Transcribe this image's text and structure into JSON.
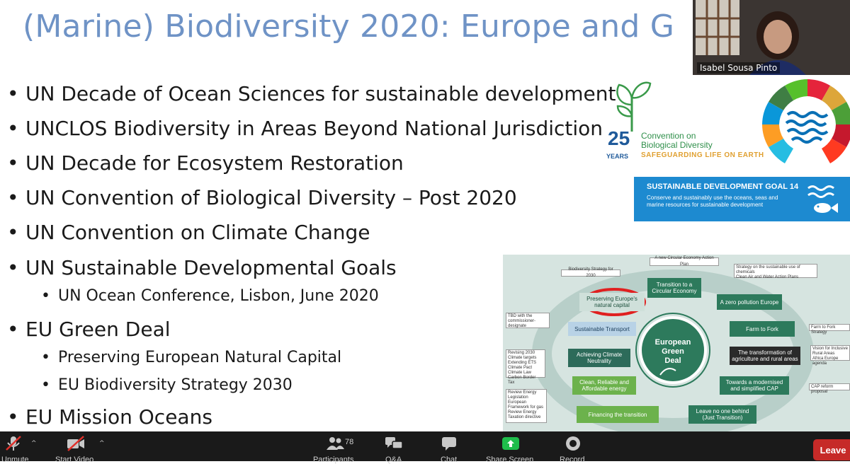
{
  "slide": {
    "title": "(Marine) Biodiversity 2020: Europe and G",
    "bullets": [
      "UN Decade of Ocean Sciences for sustainable development",
      "UNCLOS Biodiversity in Areas Beyond National Jurisdiction",
      "UN Decade for Ecosystem Restoration",
      "UN Convention of Biological Diversity – Post 2020",
      "UN Convention on Climate Change",
      "UN Sustainable Developmental Goals",
      "EU Green Deal",
      "EU Mission Oceans"
    ],
    "sub_bullets": [
      "UN Ocean Conference, Lisbon, June 2020",
      "Preserving European Natural Capital",
      "EU Biodiversity Strategy 2030"
    ],
    "cbd_logo": {
      "years_number": "25",
      "years_label": "YEARS",
      "line1": "Convention on",
      "line2": "Biological Diversity",
      "tagline": "SAFEGUARDING LIFE ON EARTH"
    },
    "sdg14": {
      "heading": "SUSTAINABLE DEVELOPMENT GOAL 14",
      "text": "Conserve and sustainably use the oceans, seas and marine resources for sustainable development"
    },
    "green_deal": {
      "center": "European Green Deal",
      "boxes": {
        "circular_plan": "A new Circular Economy Action Plan",
        "biodiversity_strategy": "Biodiversity Strategy for 2030",
        "chemicals": "Strategy on the sustainable use of chemicals",
        "clean_air": "Clean Air and Water Action Plans",
        "transition": "Transition to a Circular Economy",
        "preserving": "Preserving Europe's natural capital",
        "zero_pollution": "A zero pollution Europe",
        "tbd": "TBD with the commissioner-designate",
        "transport": "Sustainable Transport",
        "farm_to_fork": "Farm to Fork",
        "farm_to_fork_strategy": "Farm to Fork Strategy",
        "climate_notes": "Revising 2030 Climate targets\nExtending ETS\nClimate Pact\nClimate Law\nCarbon Border Tax",
        "climate_neutrality": "Achieving Climate Neutrality",
        "rural": "The transformation of agriculture and rural areas",
        "vision": "Vision for Inclusive Rural Areas\nAfrica Europe agenda",
        "energy": "Clean, Reliable and Affordable energy",
        "cap": "Towards a modernised and simplified CAP",
        "cap_reform": "CAP reform proposal",
        "energy_notes": "Review Energy Legislation\nEuropean Framework for gas\nReview Energy Taxation directive",
        "financing": "Financing the transition",
        "leave_no_one": "Leave no one behind (Just Transition)"
      }
    }
  },
  "video": {
    "participant_name": "Isabel Sousa Pinto"
  },
  "toolbar": {
    "unmute": "Unmute",
    "start_video": "Start Video",
    "participants": "Participants",
    "participants_count": "78",
    "qa": "Q&A",
    "chat": "Chat",
    "share_screen": "Share Screen",
    "record": "Record",
    "leave": "Leave",
    "caret": "^"
  },
  "colors": {
    "title": "#6f93c6",
    "toolbar_bg": "#1a1a1a",
    "leave_bg": "#c62a28",
    "share_green": "#1fbd4b",
    "sdg_blue": "#1d8ad0",
    "gd_dark_green": "#2d6b4a",
    "gd_light_green": "#6cb24c"
  }
}
